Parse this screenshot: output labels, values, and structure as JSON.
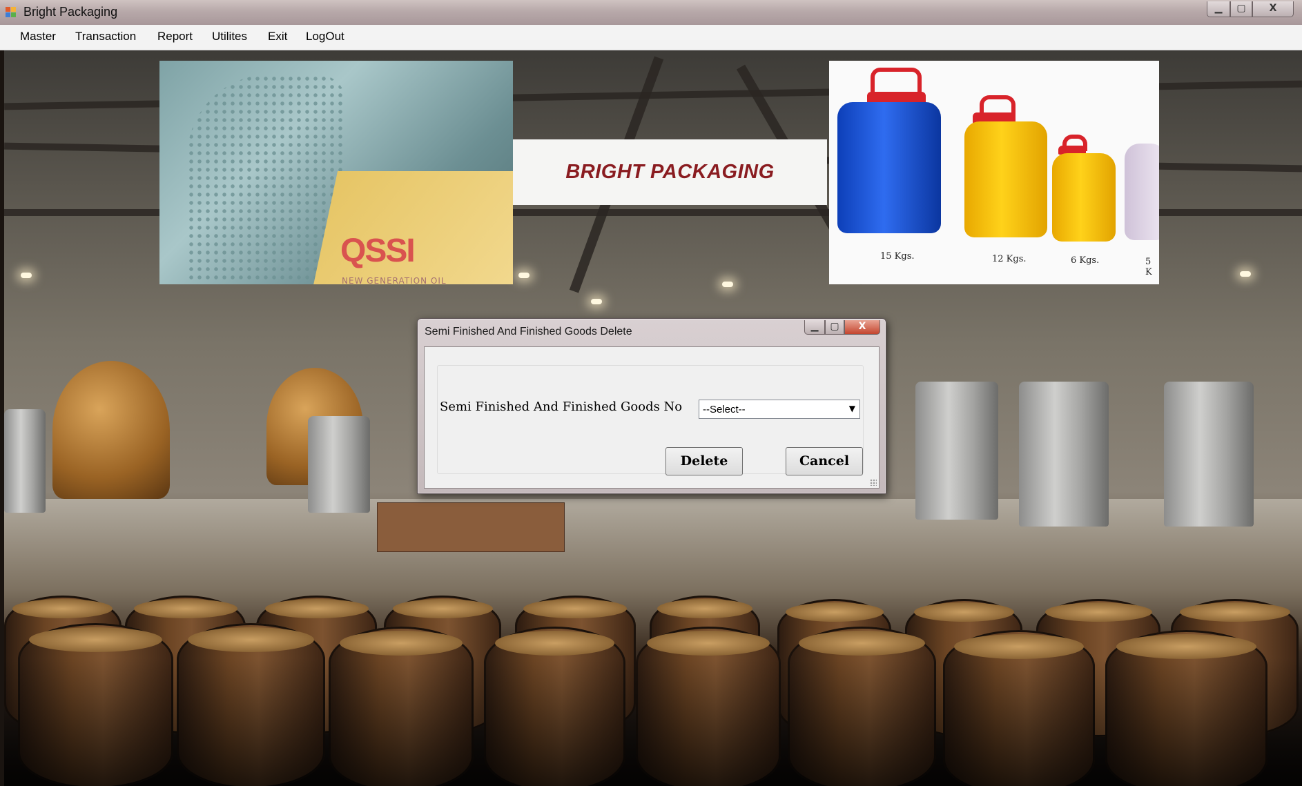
{
  "window": {
    "title": "Bright Packaging",
    "controls": {
      "minimize": "▁",
      "maximize": "▢",
      "close": "X"
    }
  },
  "menu": [
    "Master",
    "Transaction",
    "Report",
    "Utilites",
    "Exit",
    "LogOut"
  ],
  "banner": {
    "brand_text": "BRIGHT PACKAGING",
    "bottle_logo": "QSSI",
    "bottle_slogan": "NEW GENERATION OIL",
    "can_labels": [
      "15 Kgs.",
      "12 Kgs.",
      "6 Kgs.",
      "5 K"
    ]
  },
  "dialog": {
    "title": "Semi Finished And Finished Goods Delete",
    "controls": {
      "minimize": "▁",
      "maximize": "▢",
      "close": "X"
    },
    "field_label": "Semi Finished And Finished Goods No",
    "select_value": "--Select--",
    "delete_label": "Delete",
    "cancel_label": "Cancel"
  },
  "colors": {
    "brand_text": "#8a1c20",
    "menu_bg": "#f3f3f3",
    "dialog_bg": "#f0f0f0"
  }
}
